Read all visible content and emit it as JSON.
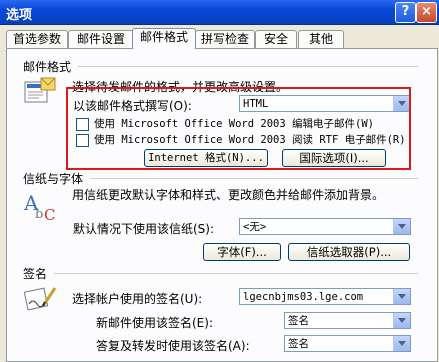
{
  "window": {
    "title": "选项",
    "help_label": "?",
    "close_label": "×"
  },
  "tabs": [
    {
      "label": "首选参数"
    },
    {
      "label": "邮件设置"
    },
    {
      "label": "邮件格式"
    },
    {
      "label": "拼写检查"
    },
    {
      "label": "安全"
    },
    {
      "label": "其他"
    }
  ],
  "active_tab": "邮件格式",
  "mail_format": {
    "section_title": "邮件格式",
    "description": "选择待发邮件的格式，并更改高级设置。",
    "compose_label": "以该邮件格式撰写(O):",
    "compose_value": "HTML",
    "word_edit_label": "使用 Microsoft Office Word 2003 编辑电子邮件(W)",
    "word_edit_checked": false,
    "word_read_label": "使用 Microsoft Office Word 2003 阅读 RTF 电子邮件(R)",
    "word_read_checked": false,
    "internet_format_button": "Internet 格式(N)...",
    "intl_options_button": "国际选项(I)..."
  },
  "stationery": {
    "section_title": "信纸与字体",
    "description": "用信纸更改默认字体和样式、更改颜色并给邮件添加背景。",
    "default_label": "默认情况下使用该信纸(S):",
    "default_value": "<无>",
    "font_button": "字体(F)...",
    "picker_button": "信纸选取器(P)..."
  },
  "signature": {
    "section_title": "签名",
    "account_label": "选择帐户使用的签名(U):",
    "account_value": "lgecnbjms03.lge.com",
    "new_label": "新邮件使用该签名(E):",
    "new_value": "签名",
    "reply_label": "答复及转发时使用该签名(A):",
    "reply_value": "签名"
  },
  "colors": {
    "highlight": "#d81a1a",
    "title_bar": "#0a46d6"
  }
}
